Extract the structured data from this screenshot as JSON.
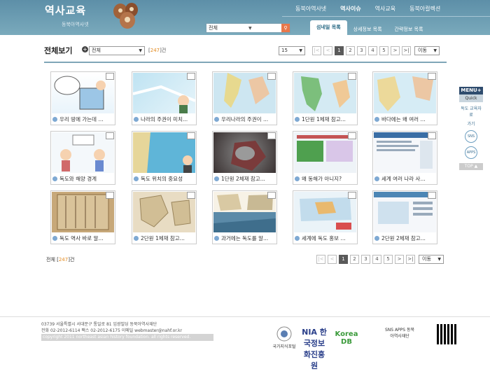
{
  "header": {
    "logo_title": "역사교육",
    "logo_subtitle": "동북아역사넷",
    "top_nav": [
      "동북아역사넷",
      "역사이슈",
      "역사교육",
      "동북아컬렉션"
    ],
    "top_nav_active": "역사이슈",
    "search_select": "전체",
    "tabs": [
      "섬네일 목록",
      "상세정보 목록",
      "간략정보 목록"
    ],
    "active_tab": "섬네일 목록"
  },
  "toolbar": {
    "title": "전체보기",
    "filter_value": "전체",
    "count_prefix": "[",
    "count": "247",
    "count_suffix": "]건",
    "per_page": "15"
  },
  "pager": {
    "first": "|<",
    "prev": "<",
    "pages": [
      "1",
      "2",
      "3",
      "4",
      "5"
    ],
    "current": "1",
    "next": ">",
    "last": ">|",
    "move_label": "이동"
  },
  "items": [
    {
      "label": "우리 땅에 가는데 ..."
    },
    {
      "label": "나라의 주권이 미치..."
    },
    {
      "label": "우리나라의 주권이 ..."
    },
    {
      "label": "1단원 1체재 참고..."
    },
    {
      "label": "바다에는 왜 여러 ..."
    },
    {
      "label": "독도와 해양 경계"
    },
    {
      "label": "독도 위치의 중요성"
    },
    {
      "label": "1단원 2체재 참고..."
    },
    {
      "label": "왜 동해가 아니지?"
    },
    {
      "label": "세계 여러 나라 사..."
    },
    {
      "label": "독도 역사 바로 알..."
    },
    {
      "label": "2단원 1체재 참고..."
    },
    {
      "label": "과거에는 독도를 알..."
    },
    {
      "label": "세계에 독도 홍보 ..."
    },
    {
      "label": "2단원 2체재 참고..."
    }
  ],
  "bottom": {
    "total_prefix": "전체 [",
    "total": "247",
    "total_suffix": "]건"
  },
  "quick_menu": {
    "menu": "MENU+",
    "quick": "Quick",
    "item1": "독도 교육자료",
    "item2": "가기",
    "sns": "SNS",
    "apps": "APPS",
    "top": "TOP ▲"
  },
  "footer": {
    "address": "03739 서울특별시 서대문구 통일로 81 임광빌딩 동북아역사재단",
    "contact": "전화 02-2012-6114 팩스 02-2012-6175 이메일 webmaster@nahf.or.kr",
    "copyright": "copyright 2011 northeast asian history foundation. all rights reserved.",
    "partners": [
      "국가지식포털",
      "NIA 한국정보화진흥원",
      "Korea DB",
      "SNS APPS 동북아역사재단"
    ]
  }
}
